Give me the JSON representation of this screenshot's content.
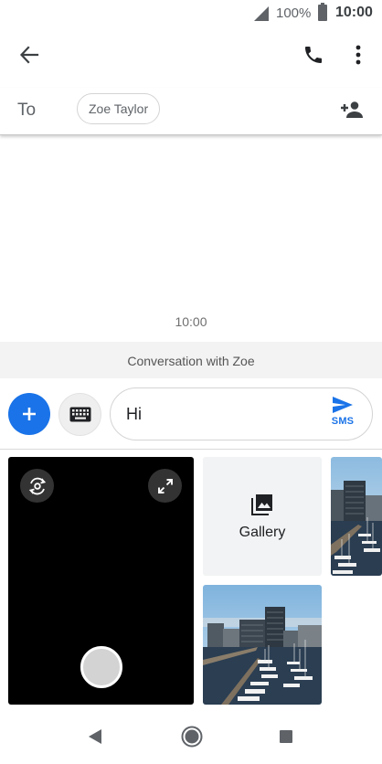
{
  "status_bar": {
    "battery_percent": "100%",
    "time": "10:00",
    "icons": [
      "signal-icon",
      "battery-icon"
    ]
  },
  "app_bar": {
    "icons": [
      "back-arrow-icon",
      "phone-icon",
      "more-vert-icon"
    ]
  },
  "recipients": {
    "to_label": "To",
    "chip": "Zoe Taylor",
    "add_icon": "add-person-icon"
  },
  "conversation": {
    "timestamp": "10:00",
    "banner": "Conversation with Zoe"
  },
  "compose": {
    "message": "Hi",
    "send_label": "SMS",
    "accent": "#1a73e8",
    "icons": [
      "plus-icon",
      "keyboard-icon",
      "send-icon"
    ]
  },
  "media": {
    "gallery_label": "Gallery",
    "icons": [
      "switch-camera-icon",
      "fullscreen-icon",
      "gallery-icon"
    ]
  },
  "nav_bar": {
    "icons": [
      "back-triangle-icon",
      "home-circle-icon",
      "recents-square-icon"
    ]
  }
}
